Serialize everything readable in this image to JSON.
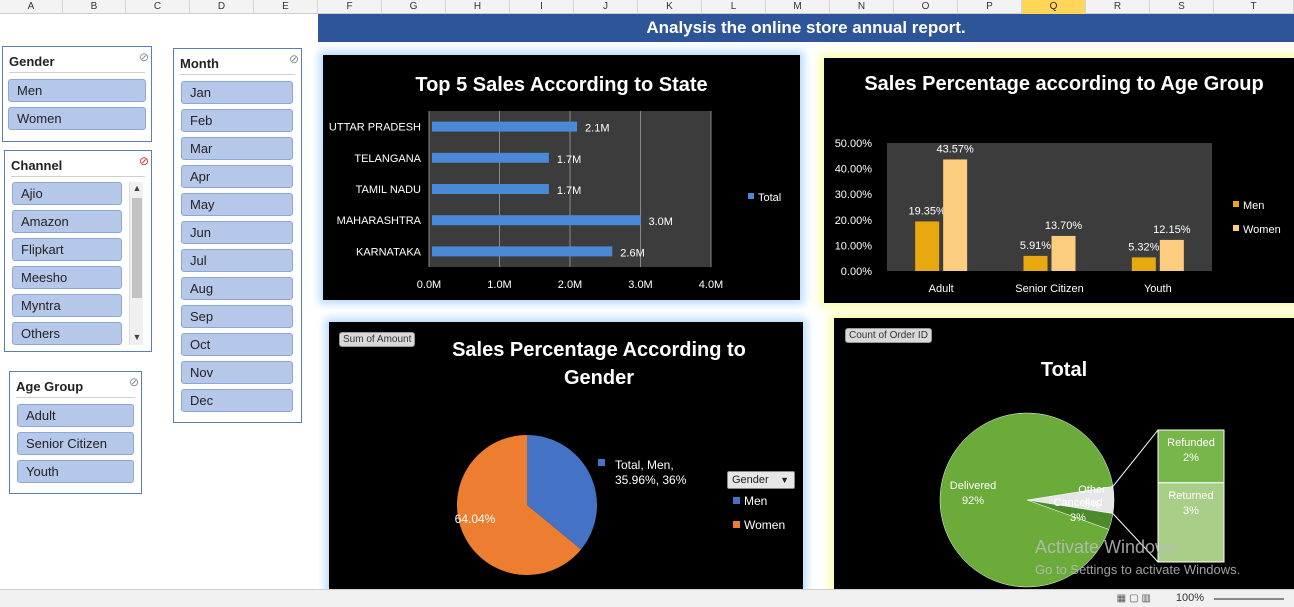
{
  "column_headers": [
    "A",
    "B",
    "C",
    "D",
    "E",
    "F",
    "G",
    "H",
    "I",
    "J",
    "K",
    "L",
    "M",
    "N",
    "O",
    "P",
    "Q",
    "R",
    "S",
    "T"
  ],
  "selected_column": "Q",
  "banner": "Analysis the online store annual report.",
  "slicers": {
    "gender": {
      "title": "Gender",
      "items": [
        "Men",
        "Women"
      ]
    },
    "channel": {
      "title": "Channel",
      "items": [
        "Ajio",
        "Amazon",
        "Flipkart",
        "Meesho",
        "Myntra",
        "Others"
      ]
    },
    "age_group": {
      "title": "Age Group",
      "items": [
        "Adult",
        "Senior Citizen",
        "Youth"
      ]
    },
    "month": {
      "title": "Month",
      "items": [
        "Jan",
        "Feb",
        "Mar",
        "Apr",
        "May",
        "Jun",
        "Jul",
        "Aug",
        "Sep",
        "Oct",
        "Nov",
        "Dec"
      ]
    }
  },
  "panels": {
    "gender_tag": "Sum of Amount",
    "order_tag": "Count of Order ID",
    "gender_filter_button": "Gender"
  },
  "chart_data": [
    {
      "type": "bar",
      "title": "Top 5 Sales According to State",
      "categories": [
        "UTTAR PRADESH",
        "TELANGANA",
        "TAMIL NADU",
        "MAHARASHTRA",
        "KARNATAKA"
      ],
      "values": [
        2.1,
        1.7,
        1.7,
        3.0,
        2.6
      ],
      "data_labels": [
        "2.1M",
        "1.7M",
        "1.7M",
        "3.0M",
        "2.6M"
      ],
      "x_ticks": [
        "0.0M",
        "1.0M",
        "2.0M",
        "3.0M",
        "4.0M"
      ],
      "xlim": [
        0,
        4
      ],
      "series": [
        {
          "name": "Total",
          "values": [
            2.1,
            1.7,
            1.7,
            3.0,
            2.6
          ]
        }
      ],
      "legend": "right",
      "grid": true,
      "color": "#4a89d8"
    },
    {
      "type": "bar",
      "title": "Sales Percentage  according to Age Group",
      "categories": [
        "Adult",
        "Senior Citizen",
        "Youth"
      ],
      "series": [
        {
          "name": "Men",
          "values": [
            19.35,
            5.91,
            5.32
          ],
          "labels": [
            "19.35%",
            "5.91%",
            "5.32%"
          ],
          "color": "#e8a80f"
        },
        {
          "name": "Women",
          "values": [
            43.57,
            13.7,
            12.15
          ],
          "labels": [
            "43.57%",
            "13.70%",
            "12.15%"
          ],
          "color": "#fdcd7f"
        }
      ],
      "y_ticks": [
        "50.00%",
        "40.00%",
        "30.00%",
        "20.00%",
        "10.00%",
        "0.00%"
      ],
      "ylim": [
        0,
        50
      ],
      "legend": "right"
    },
    {
      "type": "pie",
      "title": "Sales Percentage According to Gender",
      "slices": [
        {
          "name": "Men",
          "value": 35.96,
          "label": "Total, Men, 35.96%, 36%",
          "color": "#4472c4"
        },
        {
          "name": "Women",
          "value": 64.04,
          "label": "64.04%",
          "color": "#ed7d31"
        }
      ],
      "legend": "right"
    },
    {
      "type": "pie",
      "title": "Total",
      "slices": [
        {
          "name": "Delivered",
          "value": 92,
          "label": "Delivered\n92%",
          "color": "#6aab3a"
        },
        {
          "name": "Cancelled",
          "value": 3,
          "label": "Cancelled\n3%",
          "color": "#4d8a2a"
        },
        {
          "name": "Other",
          "value": 5,
          "label": "Other\n5%",
          "color": "#e6e6e6"
        }
      ],
      "breakdown": [
        {
          "name": "Refunded",
          "value": 2,
          "label": "Refunded\n2%",
          "color": "#77b64a"
        },
        {
          "name": "Returned",
          "value": 3,
          "label": "Returned\n3%",
          "color": "#a8ce88"
        }
      ]
    }
  ],
  "watermark": {
    "line1": "Activate Windows",
    "line2": "Go to Settings to activate Windows."
  },
  "status": {
    "zoom": "100%"
  }
}
